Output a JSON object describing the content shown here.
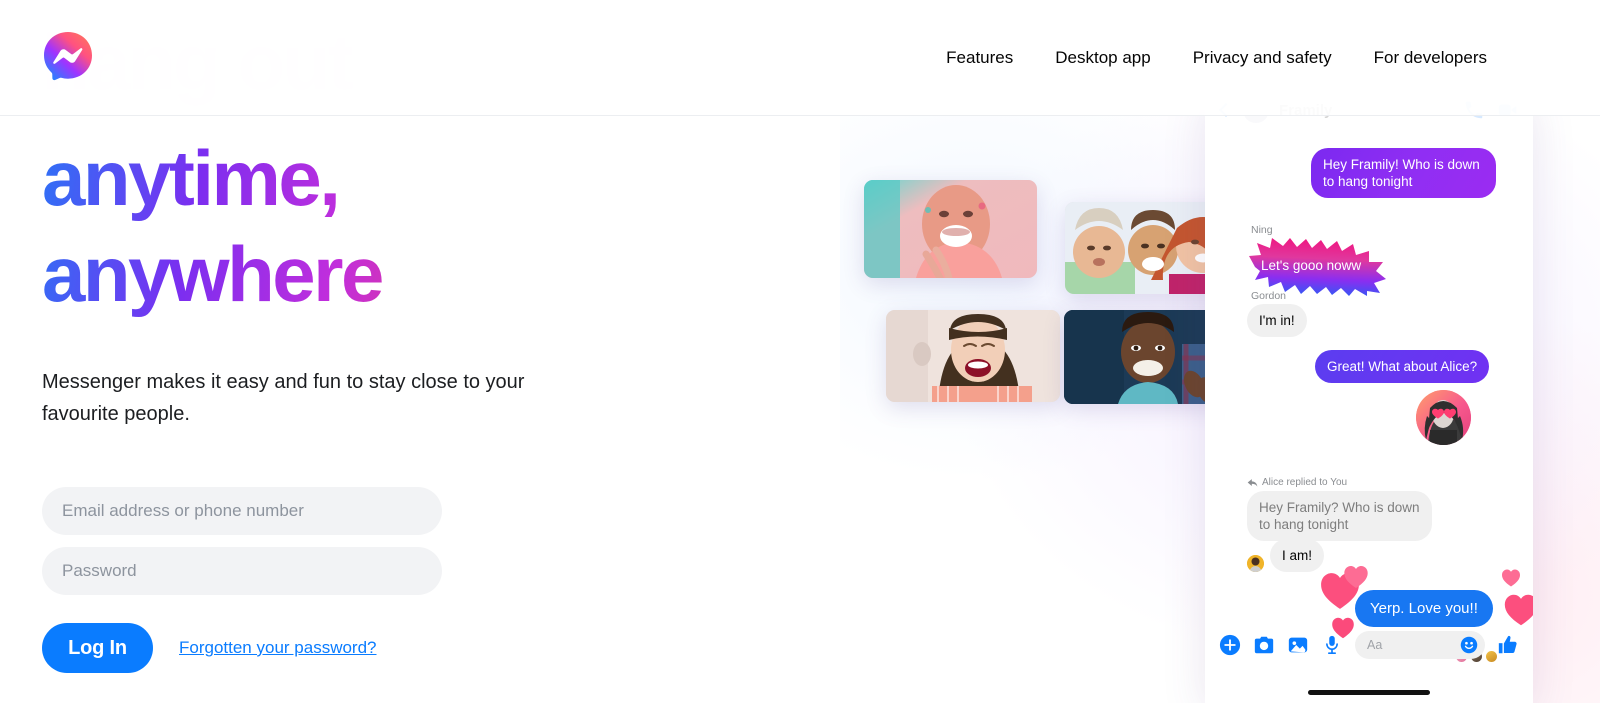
{
  "brand": {
    "logo_icon": "messenger-logo-icon",
    "gradient_start": "#0099FF",
    "gradient_mid": "#A033FF",
    "gradient_end": "#FF5280"
  },
  "ghost_headline": "hang out",
  "nav": {
    "items": [
      {
        "label": "Features"
      },
      {
        "label": "Desktop app"
      },
      {
        "label": "Privacy and safety"
      },
      {
        "label": "For developers"
      }
    ]
  },
  "hero": {
    "headline_line1": "anytime,",
    "headline_line2": "anywhere",
    "headline_gradient_start": "#2D72F6",
    "headline_gradient_end": "#F74A63",
    "subhead": "Messenger makes it easy and fun to stay close to your favourite people."
  },
  "login_form": {
    "email_placeholder": "Email address or phone number",
    "email_value": "",
    "password_placeholder": "Password",
    "password_value": "",
    "login_label": "Log In",
    "login_color": "#0A7CFF",
    "forgot_label": "Forgotten your password?"
  },
  "collage": {
    "photos": [
      {
        "alt": "man-in-pink-hoodie-laughing"
      },
      {
        "alt": "three-friends-hugging"
      },
      {
        "alt": "woman-with-red-lipstick-laughing"
      },
      {
        "alt": "man-in-blue-being-hugged"
      }
    ]
  },
  "chat": {
    "header": {
      "title": "Framily",
      "back_icon": "back-chevron-icon",
      "avatar_icon": "group-avatar-icon",
      "call_icon": "phone-icon",
      "video_icon": "video-camera-icon"
    },
    "messages": [
      {
        "id": "m1",
        "side": "out",
        "style": "purple",
        "text": "Hey Framily! Who is down to hang tonight"
      },
      {
        "id": "m2",
        "side": "in",
        "style": "burst",
        "sender": "Ning",
        "text": "Let's gooo noww"
      },
      {
        "id": "m3",
        "side": "in",
        "style": "grey",
        "sender": "Gordon",
        "text": "I'm in!"
      },
      {
        "id": "m4",
        "side": "out",
        "style": "violet",
        "text": "Great! What about Alice?"
      },
      {
        "id": "m5",
        "side": "in",
        "style": "reply",
        "reply_meta": "Alice replied to You",
        "quote": "Hey Framily? Who is down to hang tonight",
        "text": "I am!"
      },
      {
        "id": "m6",
        "side": "out",
        "style": "blue-hearts",
        "text": "Yerp. Love you!!"
      }
    ],
    "alice_avatar": {
      "alt": "alice-avatar-with-heart-eyes",
      "sticker": "heart-eyes-sticker"
    },
    "reaction_hearts": 5,
    "seen_by_count": 3,
    "composer": {
      "plus_icon": "plus-circle-icon",
      "camera_icon": "camera-icon",
      "gallery_icon": "image-gallery-icon",
      "mic_icon": "microphone-icon",
      "input_placeholder": "Aa",
      "input_value": "",
      "emoji_icon": "smiley-face-icon",
      "like_icon": "thumbs-up-icon",
      "accent": "#0A7CFF"
    }
  }
}
